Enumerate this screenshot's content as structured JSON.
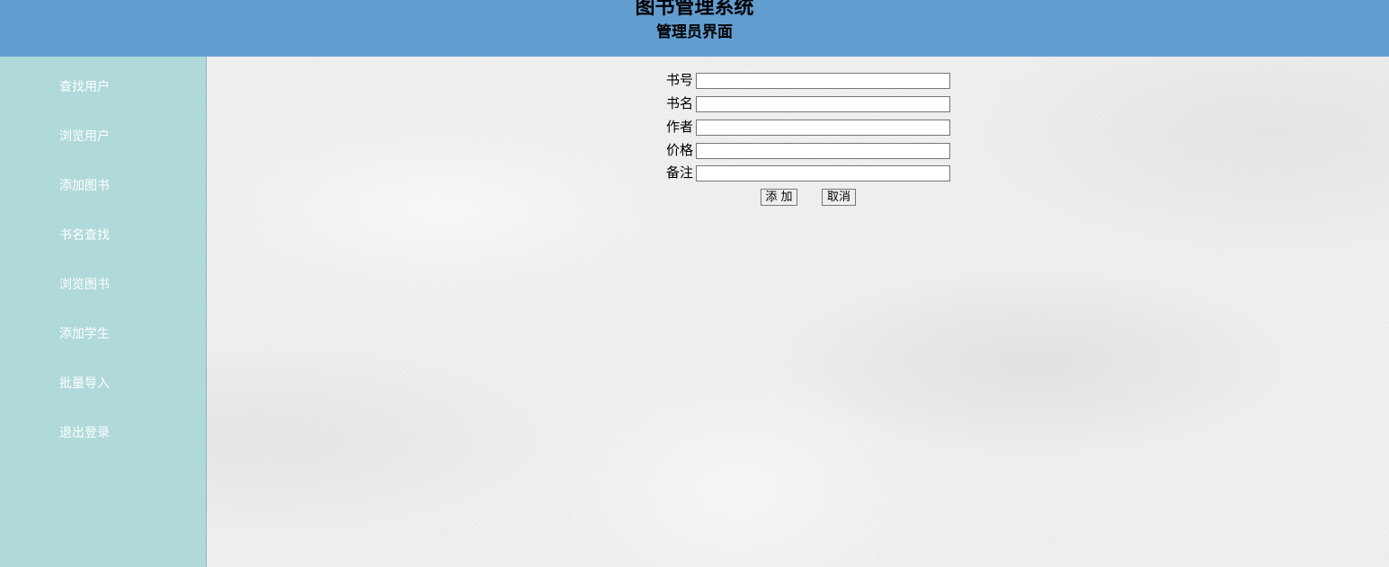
{
  "header": {
    "title": "图书管理系统",
    "subtitle": "管理员界面"
  },
  "sidebar": {
    "items": [
      {
        "label": "查找用户"
      },
      {
        "label": "浏览用户"
      },
      {
        "label": "添加图书"
      },
      {
        "label": "书名查找"
      },
      {
        "label": "浏览图书"
      },
      {
        "label": "添加学生"
      },
      {
        "label": "批量导入"
      },
      {
        "label": "退出登录"
      }
    ]
  },
  "form": {
    "fields": [
      {
        "label": "书号",
        "value": ""
      },
      {
        "label": "书名",
        "value": ""
      },
      {
        "label": "作者",
        "value": ""
      },
      {
        "label": "价格",
        "value": ""
      },
      {
        "label": "备注",
        "value": ""
      }
    ],
    "submit_label": "添 加",
    "cancel_label": "取消"
  },
  "colors": {
    "header_bg": "#629dd0",
    "sidebar_bg": "#b0d9d9",
    "sidebar_text": "#ffffff",
    "main_bg": "#efefef"
  }
}
